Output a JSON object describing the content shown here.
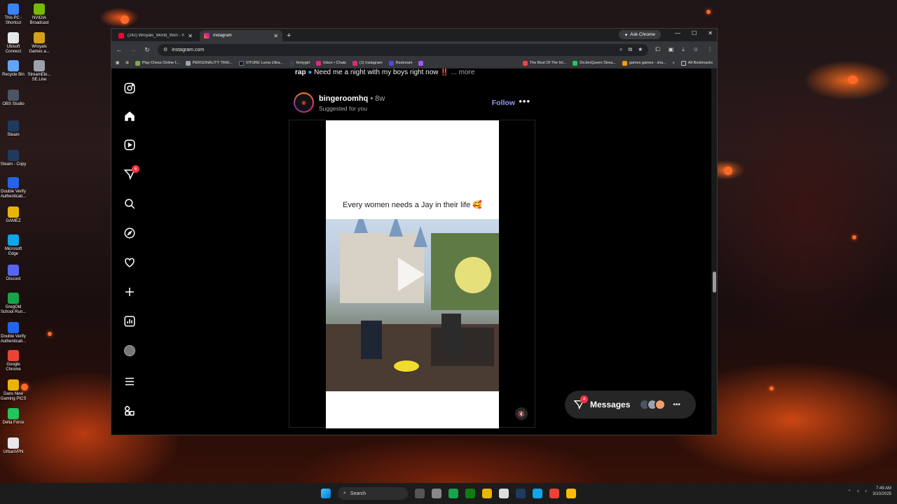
{
  "desktop": {
    "icons": [
      {
        "label": "This PC - Shortcut",
        "color": "#3b82f6"
      },
      {
        "label": "NVIDIA Broadcast",
        "color": "#76b900"
      },
      {
        "label": "Ubisoft Connect",
        "color": "#e5e7eb"
      },
      {
        "label": "Wroyals Games a...",
        "color": "#d4a017"
      },
      {
        "label": "Recycle Bin",
        "color": "#60a5fa"
      },
      {
        "label": "StreamEle... SE.Live",
        "color": "#9ca3af"
      },
      {
        "label": "OBS Studio",
        "color": "#4b5563"
      },
      {
        "label": "Steam",
        "color": "#1e3a5f"
      },
      {
        "label": "Steam - Copy",
        "color": "#1e3a5f"
      },
      {
        "label": "Double Verify Authenticati...",
        "color": "#2563eb"
      },
      {
        "label": "GAMEZ",
        "color": "#eab308"
      },
      {
        "label": "Microsoft Edge",
        "color": "#0ea5e9"
      },
      {
        "label": "Discord",
        "color": "#5865f2"
      },
      {
        "label": "GregOld School Run...",
        "color": "#16a34a"
      },
      {
        "label": "Double Verify Authenticati...",
        "color": "#2563eb"
      },
      {
        "label": "Google Chrome",
        "color": "#ea4335"
      },
      {
        "label": "Dans New Gaming PICS",
        "color": "#eab308"
      },
      {
        "label": "Delta Force",
        "color": "#22c55e"
      },
      {
        "label": "UrbanVPN",
        "color": "#e5e7eb"
      }
    ]
  },
  "browser": {
    "tabs": [
      {
        "title": "(242) Wroyals_World_Won - Yo",
        "fav_color": "#ff0033",
        "active": false
      },
      {
        "title": "Instagram",
        "fav_color": "#dd2a7b",
        "active": true
      }
    ],
    "new_tab": "+",
    "ask_chrome": "Ask Chrome",
    "url": "instagram.com",
    "bookmarks": [
      {
        "label": "Play Chess Online f...",
        "color": "#7fa650"
      },
      {
        "label": "PERSONALITY TRAI...",
        "color": "#9ca3af"
      },
      {
        "label": "VITURE Luma Ultra...",
        "color": "#111827"
      },
      {
        "label": "fentygirl",
        "color": "#374151"
      },
      {
        "label": "Inbox • Chats",
        "color": "#dd2a7b"
      },
      {
        "label": "(1) Instagram",
        "color": "#dd2a7b"
      },
      {
        "label": "Restream",
        "color": "#4f46e5"
      },
      {
        "label": "",
        "color": "#a855f7"
      },
      {
        "label": "The Best Of The Int...",
        "color": "#ef4444"
      },
      {
        "label": "DeJenQueen Strea...",
        "color": "#22c55e"
      },
      {
        "label": "games games - sha...",
        "color": "#f59e0b"
      }
    ],
    "all_bookmarks": "All Bookmarks"
  },
  "instagram": {
    "nav_badge_notifications": "6",
    "caption_user": "rap",
    "caption_text": "Need me a night with my boys right now ‼️",
    "caption_more": "... more",
    "post": {
      "username": "bingeroomhq",
      "time": "• 8w",
      "subtitle": "Suggested for you",
      "follow": "Follow",
      "more": "•••",
      "overlay_text": "Every women needs a Jay in their life 🥰"
    },
    "messages": {
      "label": "Messages",
      "badge": "4",
      "dots": "•••"
    }
  },
  "taskbar": {
    "search": "Search",
    "time": "7:49 AM",
    "date": "3/10/2025"
  }
}
